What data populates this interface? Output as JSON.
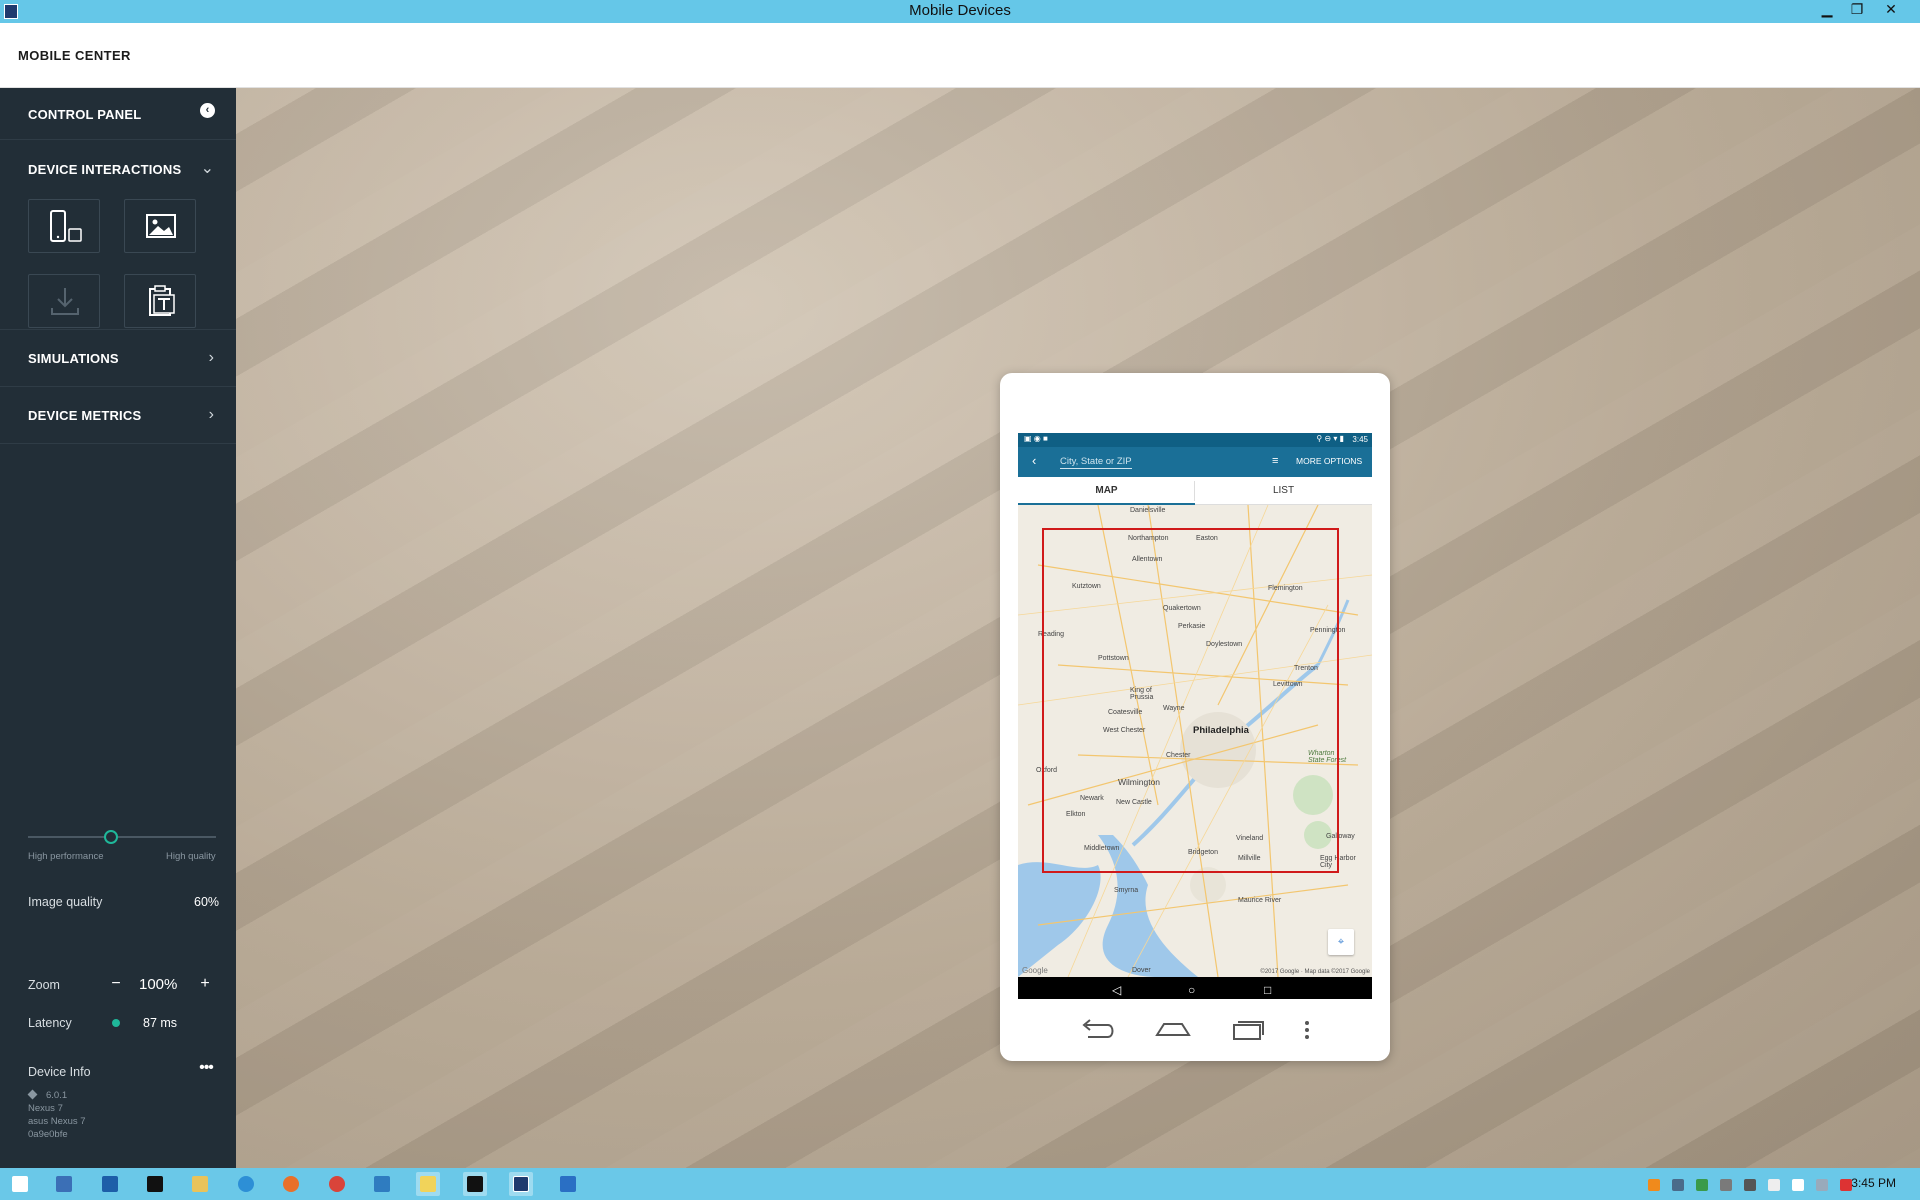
{
  "window": {
    "title": "Mobile Devices",
    "controls": [
      "minimize",
      "restore",
      "close"
    ]
  },
  "header": {
    "brand": "MOBILE CENTER"
  },
  "sidebar": {
    "control_panel": "CONTROL PANEL",
    "device_interactions": "DEVICE INTERACTIONS",
    "tiles": [
      {
        "icon": "device-orientation-icon",
        "enabled": true
      },
      {
        "icon": "image-icon",
        "enabled": true
      },
      {
        "icon": "download-icon",
        "enabled": false
      },
      {
        "icon": "text-clipboard-icon",
        "enabled": true
      }
    ],
    "simulations": "SIMULATIONS",
    "device_metrics": "DEVICE METRICS"
  },
  "controls": {
    "image_quality_label": "Image quality",
    "image_quality_value": "60%",
    "image_quality_fraction": 0.6,
    "hint_left": "High performance",
    "hint_right": "High quality",
    "zoom_label": "Zoom",
    "zoom_minus": "−",
    "zoom_value": "100%",
    "zoom_plus": "+",
    "latency_label": "Latency",
    "latency_value": "87 ms",
    "latency_color": "#1fb89a"
  },
  "device_info": {
    "title": "Device Info",
    "more": "•••",
    "version": "6.0.1",
    "model": "Nexus 7",
    "name": "asus Nexus 7",
    "id": "0a9e0bfe"
  },
  "phone": {
    "status_time": "3:45",
    "search_placeholder": "City, State or ZIP",
    "more_options": "MORE OPTIONS",
    "tabs": [
      "MAP",
      "LIST"
    ],
    "active_tab": "MAP",
    "map": {
      "places": [
        "Danielsville",
        "Northampton",
        "Easton",
        "Allentown",
        "Kutztown",
        "Flemington",
        "Quakertown",
        "Perkasie",
        "Reading",
        "Doylestown",
        "Pottstown",
        "Pennington",
        "Trenton",
        "Levittown",
        "King of Prussia",
        "Wayne",
        "Coatesville",
        "Philadelphia",
        "West Chester",
        "Chester",
        "Oxford",
        "Wilmington",
        "Newark",
        "New Castle",
        "Elkton",
        "Middletown",
        "Vineland",
        "Millville",
        "Bridgeton",
        "Wharton State Forest",
        "Egg Harbor City",
        "Galloway",
        "Smyrna",
        "Maurice River",
        "Dover"
      ],
      "copyright": "©2017 Google · Map data ©2017 Google",
      "google": "Google"
    }
  },
  "taskbar": {
    "clock": "3:45 PM",
    "accent": "#6ac8e8"
  }
}
